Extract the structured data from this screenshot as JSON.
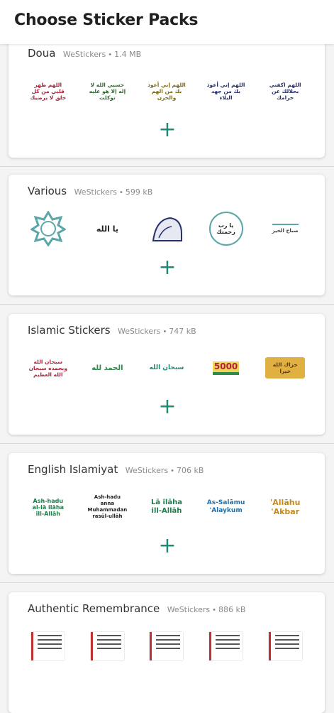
{
  "appbar": {
    "title": "Choose Sticker Packs"
  },
  "packs": [
    {
      "name": "Doua",
      "publisher": "WeStickers",
      "size": "1.4 MB",
      "stickers": [
        "اللهم طهر قلبي من كل خلق لا يرضيك",
        "حسبي الله لا إله إلا هو عليه توكلت",
        "اللهم إني أعوذ بك من الهم والحزن",
        "اللهم إني أعوذ بك من جهد البلاء",
        "اللهم اكفني بحلالك عن حرامك"
      ]
    },
    {
      "name": "Various",
      "publisher": "WeStickers",
      "size": "599 kB",
      "stickers": [
        "الله",
        "يا الله",
        "",
        "يا رب رحمتك",
        "صباح الخير"
      ]
    },
    {
      "name": "Islamic Stickers",
      "publisher": "WeStickers",
      "size": "747 kB",
      "stickers": [
        "سبحان الله وبحمده سبحان الله العظيم",
        "الحمد لله",
        "سبحان الله",
        "5000",
        "جزاك الله خيرا"
      ]
    },
    {
      "name": "English Islamiyat",
      "publisher": "WeStickers",
      "size": "706 kB",
      "stickers": [
        "Ash-hadu al-lā ilāha ill-Allāh",
        "Ash-hadu anna Muhammadan rasūl-ullāh",
        "Lā ilāha ill-Allāh",
        "As-Salāmu 'Alaykum",
        "'Allāhu 'Akbar"
      ]
    },
    {
      "name": "Authentic Remembrance",
      "publisher": "WeStickers",
      "size": "886 kB",
      "stickers": [
        "",
        "",
        "",
        "",
        ""
      ]
    }
  ],
  "colors": {
    "accent": "#1f8a77",
    "doua_red": "#b0223a",
    "doua_green": "#2e6b2e",
    "doua_olive": "#7a6a1a",
    "doua_navy": "#27306b",
    "teal": "#5aa6a8",
    "english_green": "#1a7f4a",
    "english_red": "#b4233a"
  },
  "icons": {
    "add": "plus-icon"
  }
}
